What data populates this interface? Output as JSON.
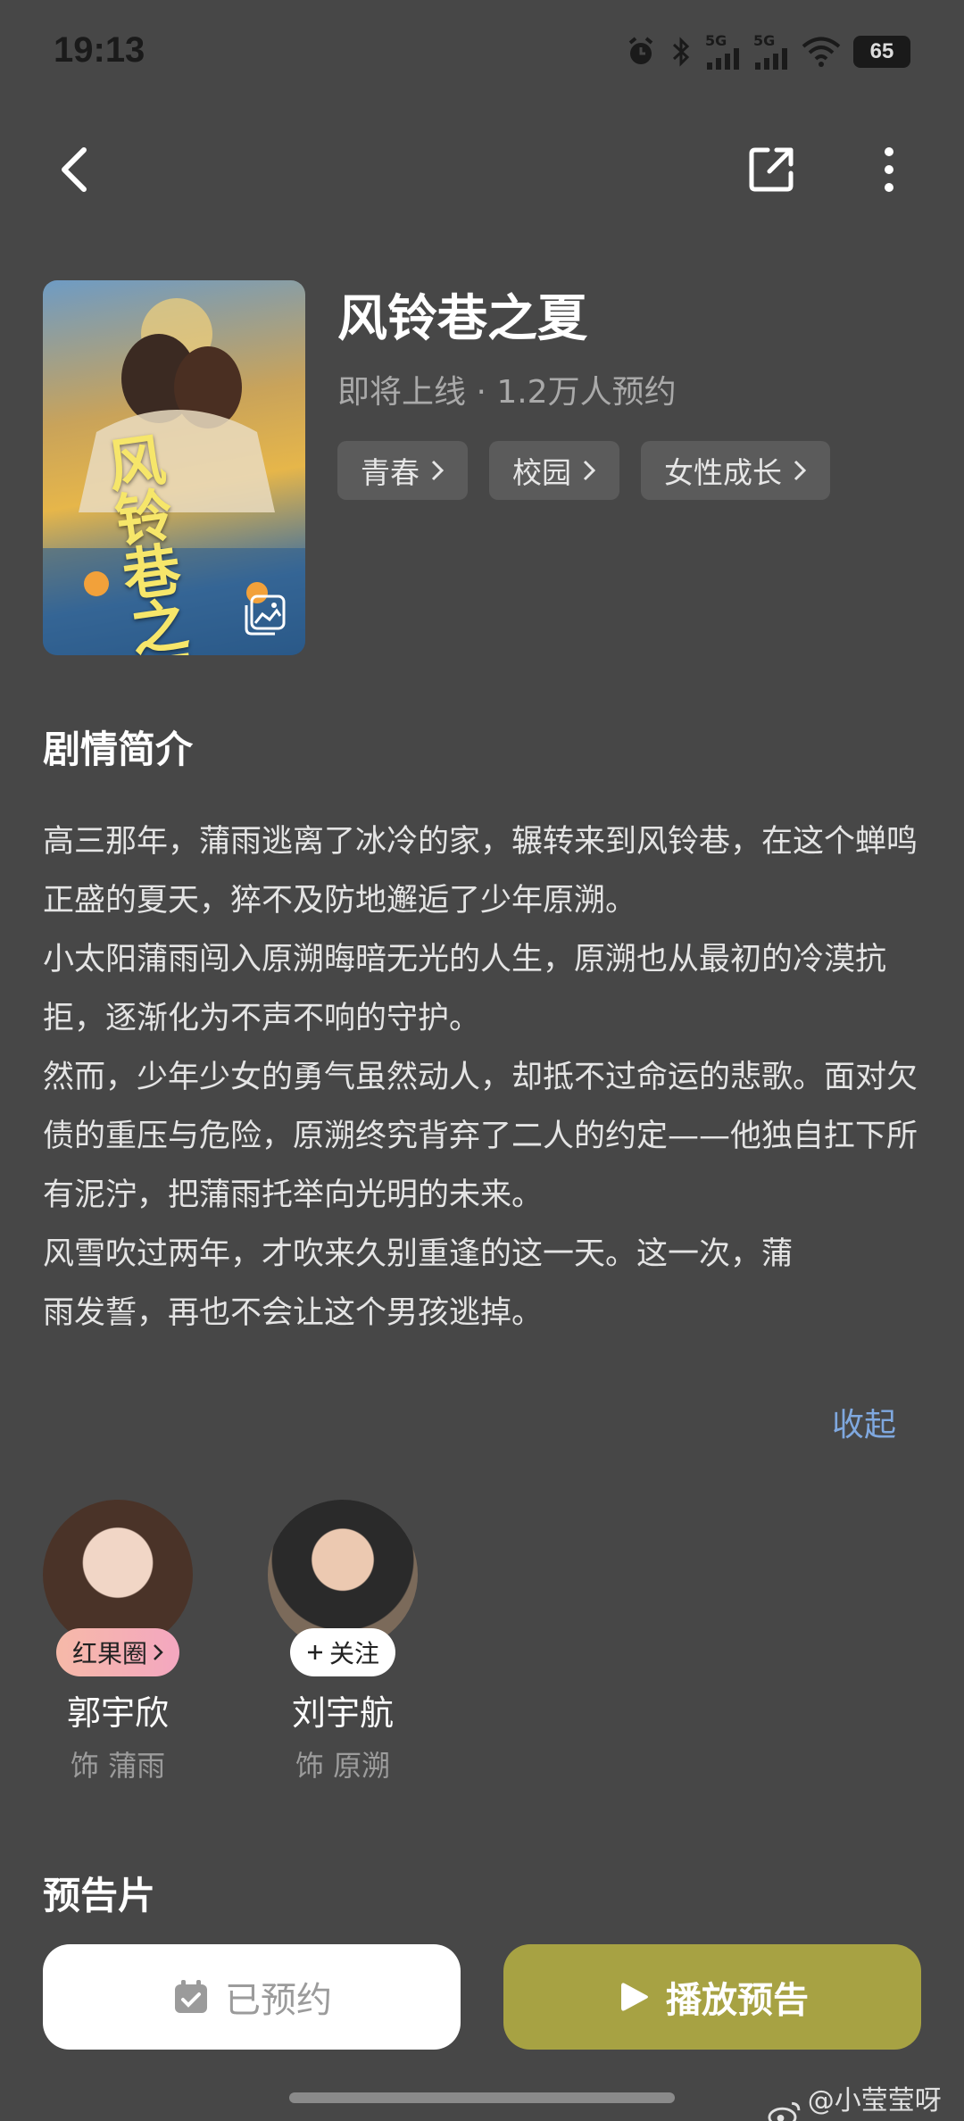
{
  "status_bar": {
    "time": "19:13",
    "battery": "65",
    "network_labels": [
      "5G",
      "5G"
    ]
  },
  "drama": {
    "title": "风铃巷之夏",
    "meta": "即将上线 · 1.2万人预约",
    "poster_title": "风铃巷之夏",
    "tags": [
      "青春",
      "校园",
      "女性成长"
    ]
  },
  "synopsis": {
    "heading": "剧情简介",
    "paragraphs": [
      "高三那年，蒲雨逃离了冰冷的家，辗转来到风铃巷，在这个蝉鸣正盛的夏天，猝不及防地邂逅了少年原溯。",
      "小太阳蒲雨闯入原溯晦暗无光的人生，原溯也从最初的冷漠抗拒，逐渐化为不声不响的守护。",
      "然而，少年少女的勇气虽然动人，却抵不过命运的悲歌。面对欠债的重压与危险，原溯终究背弃了二人的约定——他独自扛下所有泥泞，把蒲雨托举向光明的未来。",
      "风雪吹过两年，才吹来久别重逢的这一天。这一次，蒲雨发誓，再也不会让这个男孩逃掉。"
    ],
    "collapse_label": "收起"
  },
  "cast": [
    {
      "name": "郭宇欣",
      "role": "饰 蒲雨",
      "badge": "红果圈"
    },
    {
      "name": "刘宇航",
      "role": "饰 原溯",
      "badge": "关注"
    }
  ],
  "trailer_heading": "预告片",
  "actions": {
    "reserved_label": "已预约",
    "play_label": "播放预告"
  },
  "watermark": "@小莹莹呀er",
  "colors": {
    "background": "#474747",
    "accent_play": "#a7a243",
    "link": "#7fa8df"
  }
}
